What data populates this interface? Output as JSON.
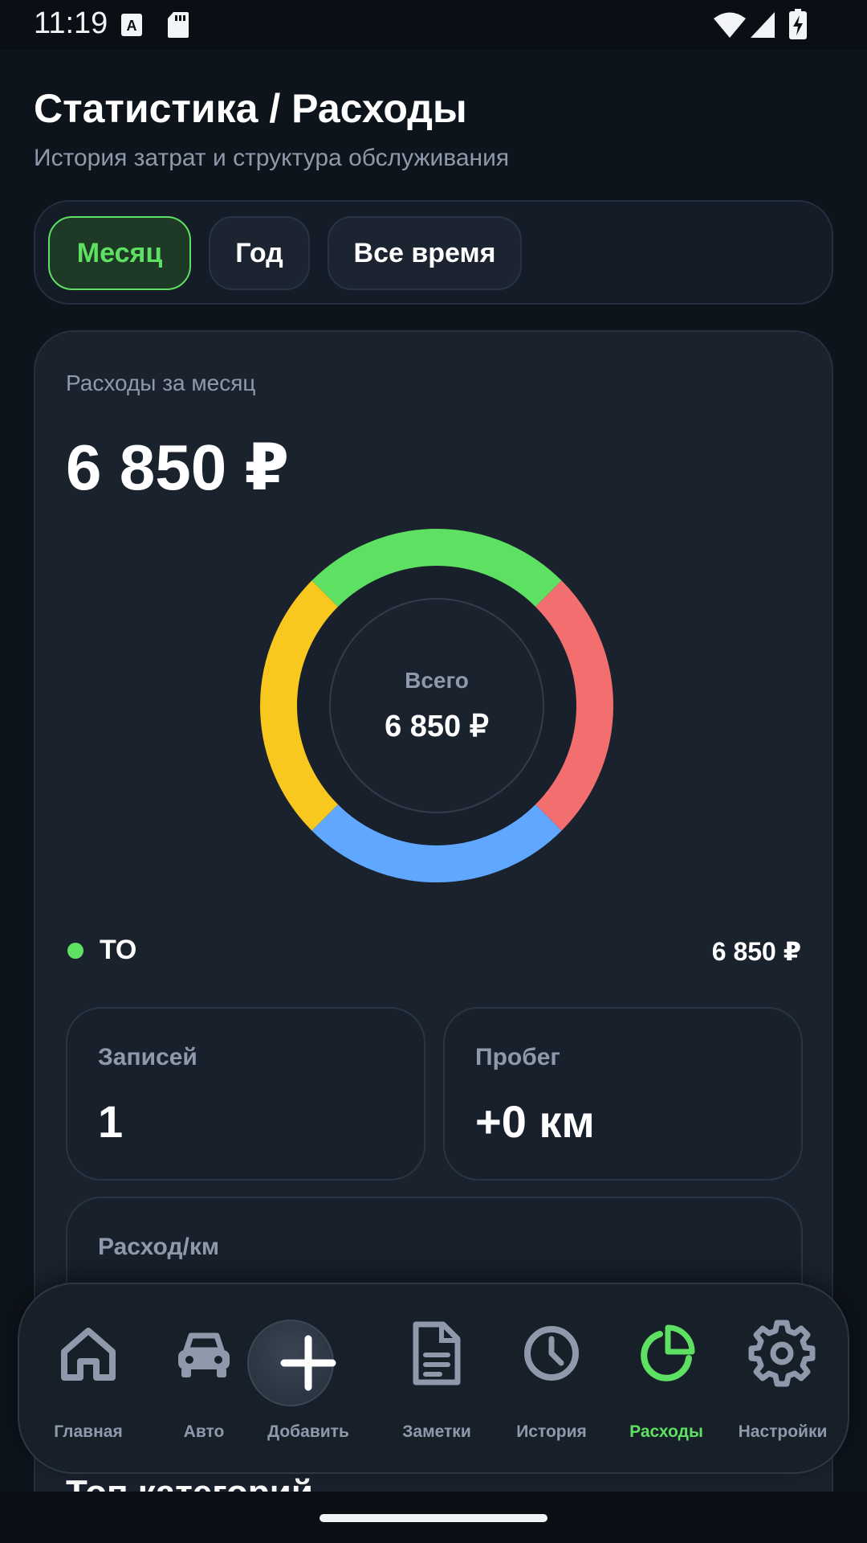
{
  "status_bar": {
    "time": "11:19"
  },
  "header": {
    "title": "Статистика / Расходы",
    "subtitle": "История затрат и структура обслуживания"
  },
  "period_tabs": [
    {
      "label": "Месяц",
      "active": true
    },
    {
      "label": "Год",
      "active": false
    },
    {
      "label": "Все время",
      "active": false
    }
  ],
  "summary": {
    "label": "Расходы за месяц",
    "total": "6 850 ₽",
    "donut_center_label": "Всего",
    "donut_center_value": "6 850 ₽",
    "donut_colors": [
      "#5ee062",
      "#f36f6f",
      "#60a7ff",
      "#f9c81e"
    ],
    "legend": [
      {
        "label": "ТО",
        "value": "6 850 ₽",
        "color": "#5ee062"
      }
    ]
  },
  "metrics": {
    "records": {
      "label": "Записей",
      "value": "1"
    },
    "mileage": {
      "label": "Пробег",
      "value": "+0 км"
    },
    "cost_per_km": {
      "label": "Расход/км"
    }
  },
  "top_categories_title": "Топ категорий",
  "bottom_nav": {
    "items": [
      {
        "label": "Главная",
        "icon": "home-icon"
      },
      {
        "label": "Авто",
        "icon": "car-icon"
      },
      {
        "label": "Добавить",
        "icon": "plus-icon"
      },
      {
        "label": "Заметки",
        "icon": "notes-icon"
      },
      {
        "label": "История",
        "icon": "clock-icon"
      },
      {
        "label": "Расходы",
        "icon": "pie-chart-icon",
        "active": true
      },
      {
        "label": "Настройки",
        "icon": "gear-icon"
      }
    ],
    "accent_color": "#5ee062"
  }
}
